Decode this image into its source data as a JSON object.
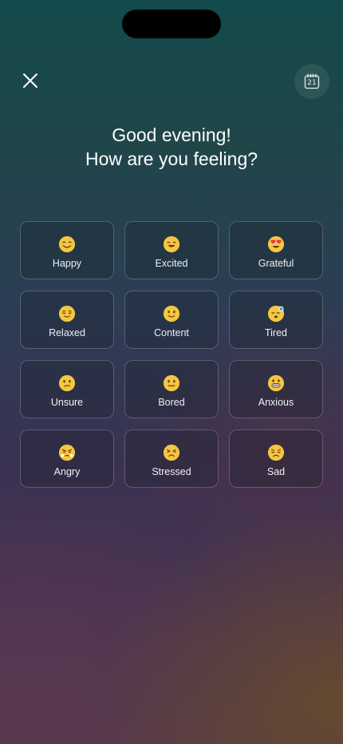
{
  "header": {
    "greeting": "Good evening!",
    "question": "How are you feeling?",
    "close_icon": "close-icon",
    "calendar_icon": "calendar-icon",
    "calendar_day": "21"
  },
  "moods": [
    {
      "label": "Happy",
      "icon": "smiling-face-icon"
    },
    {
      "label": "Excited",
      "icon": "grinning-face-icon"
    },
    {
      "label": "Grateful",
      "icon": "heart-eyes-face-icon"
    },
    {
      "label": "Relaxed",
      "icon": "relieved-face-icon"
    },
    {
      "label": "Content",
      "icon": "slightly-smiling-face-icon"
    },
    {
      "label": "Tired",
      "icon": "sleepy-face-icon"
    },
    {
      "label": "Unsure",
      "icon": "confused-face-icon"
    },
    {
      "label": "Bored",
      "icon": "neutral-face-icon"
    },
    {
      "label": "Anxious",
      "icon": "grimacing-face-icon"
    },
    {
      "label": "Angry",
      "icon": "steaming-face-icon"
    },
    {
      "label": "Stressed",
      "icon": "persevering-face-icon"
    },
    {
      "label": "Sad",
      "icon": "disappointed-face-icon"
    }
  ],
  "colors": {
    "emoji_face": "#f6c640",
    "emoji_feature": "#5b3a12",
    "heart": "#e2354b",
    "card_border": "rgba(255,255,255,0.22)",
    "text": "#ffffff"
  }
}
